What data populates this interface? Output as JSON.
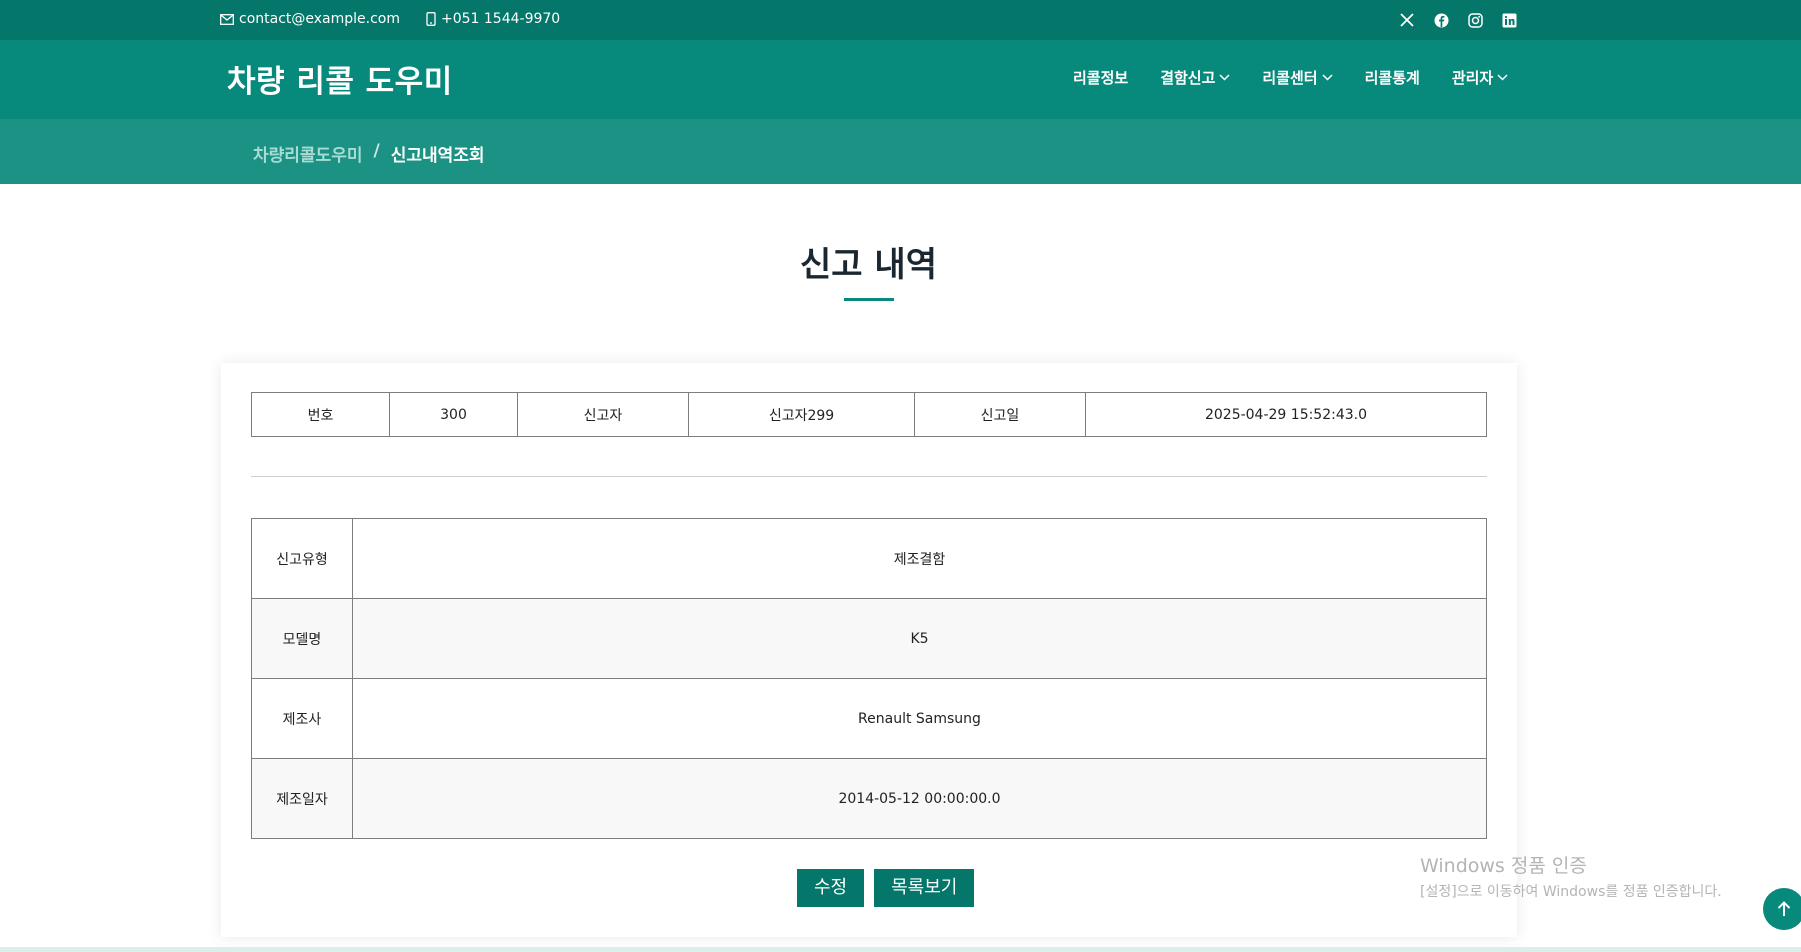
{
  "topbar": {
    "email": "contact@example.com",
    "phone": "+051 1544-9970",
    "social_icons": [
      "x-icon",
      "facebook-icon",
      "instagram-icon",
      "linkedin-icon"
    ]
  },
  "header": {
    "logo": "차량 리콜 도우미",
    "nav": [
      {
        "label": "리콜정보",
        "dropdown": false
      },
      {
        "label": "결함신고",
        "dropdown": true
      },
      {
        "label": "리콜센터",
        "dropdown": true
      },
      {
        "label": "리콜통계",
        "dropdown": false
      },
      {
        "label": "관리자",
        "dropdown": true
      }
    ]
  },
  "breadcrumb": {
    "home": "차량리콜도우미",
    "separator": "/",
    "current": "신고내역조회"
  },
  "page": {
    "title": "신고 내역"
  },
  "report_summary": {
    "number_label": "번호",
    "number_value": "300",
    "reporter_label": "신고자",
    "reporter_value": "신고자299",
    "date_label": "신고일",
    "date_value": "2025-04-29 15:52:43.0"
  },
  "report_details": [
    {
      "label": "신고유형",
      "value": "제조결함"
    },
    {
      "label": "모델명",
      "value": "K5"
    },
    {
      "label": "제조사",
      "value": "Renault Samsung"
    },
    {
      "label": "제조일자",
      "value": "2014-05-12 00:00:00.0"
    }
  ],
  "buttons": {
    "edit": "수정",
    "list": "목록보기"
  },
  "watermark": {
    "title": "Windows 정품 인증",
    "subtitle": "[설정]으로 이동하여 Windows를 정품 인증합니다."
  },
  "colors": {
    "topbar": "#04766a",
    "header": "#078a7c",
    "breadcrumb_bar": "#1b9283",
    "accent": "#078a7c"
  }
}
